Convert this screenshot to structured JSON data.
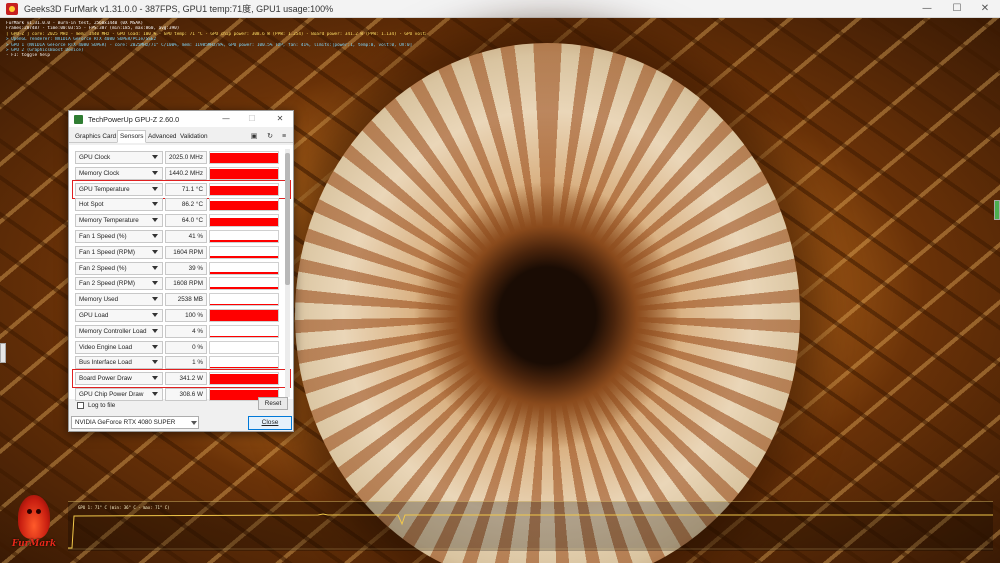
{
  "furmark": {
    "window_title": "Geeks3D FurMark v1.31.0.0 - 387FPS, GPU1 temp:71度, GPU1 usage:100%",
    "overlay": [
      "FurMark v1.31.0.0 - Burn-in test, 2560x1440 (0X MSAA)",
      "Frames:287487 - time:00:03:55 - FPS:387 (min:185, max:860, avg:390)",
      "[ GPU-Z ] core: 2025 MHz - mem: 1440 MHz - GPU load: 100 % - GPU temp: 71 °C - GPU chip power: 308.6 W (PPW: 1.254) - Board power: 341.2 W (PPW: 1.134) - GPU voltage: 0.990 V",
      "> OpenGL renderer: NVIDIA GeForce RTX 4080 SUPER/PCIe/SSE2",
      "> GPU 1 (NVIDIA GeForce RTX 4080 SUPER) - core: 2025MHz/71° C/100%, mem: 11985MHz/8%, GPU power: 100.5% TDP, fan: 41%, limits:[power:1, temp:0, volt:0, OV:0]",
      "> GPU 2 (GraphicsBoost Device)",
      "- F1: toggle help"
    ],
    "graph_label": "GPU 1: 71° C (min: 36° C - max: 71° C)",
    "logo_text": "FurMark"
  },
  "gpuz": {
    "title": "TechPowerUp GPU-Z 2.60.0",
    "tabs": [
      "Graphics Card",
      "Sensors",
      "Advanced",
      "Validation"
    ],
    "active_tab": "Sensors",
    "sensors": [
      {
        "label": "GPU Clock",
        "value": "2025.0 MHz",
        "level": 0.9,
        "highlight": false
      },
      {
        "label": "Memory Clock",
        "value": "1440.2 MHz",
        "level": 0.9,
        "highlight": false
      },
      {
        "label": "GPU Temperature",
        "value": "71.1 °C",
        "level": 0.8,
        "highlight": true
      },
      {
        "label": "Hot Spot",
        "value": "86.2 °C",
        "level": 0.8,
        "highlight": false
      },
      {
        "label": "Memory Temperature",
        "value": "64.0 °C",
        "level": 0.7,
        "highlight": false
      },
      {
        "label": "Fan 1 Speed (%)",
        "value": "41 %",
        "level": 0.2,
        "highlight": false
      },
      {
        "label": "Fan 1 Speed (RPM)",
        "value": "1604 RPM",
        "level": 0.2,
        "highlight": false
      },
      {
        "label": "Fan 2 Speed (%)",
        "value": "39 %",
        "level": 0.2,
        "highlight": false
      },
      {
        "label": "Fan 2 Speed (RPM)",
        "value": "1608 RPM",
        "level": 0.2,
        "highlight": false
      },
      {
        "label": "Memory Used",
        "value": "2538 MB",
        "level": 0.1,
        "highlight": false
      },
      {
        "label": "GPU Load",
        "value": "100 %",
        "level": 1.0,
        "highlight": false
      },
      {
        "label": "Memory Controller Load",
        "value": "4 %",
        "level": 0.08,
        "highlight": false
      },
      {
        "label": "Video Engine Load",
        "value": "0 %",
        "level": 0.0,
        "highlight": false
      },
      {
        "label": "Bus Interface Load",
        "value": "1 %",
        "level": 0.05,
        "highlight": false
      },
      {
        "label": "Board Power Draw",
        "value": "341.2 W",
        "level": 0.9,
        "highlight": true
      },
      {
        "label": "GPU Chip Power Draw",
        "value": "308.6 W",
        "level": 0.9,
        "highlight": false
      }
    ],
    "log_label": "Log to file",
    "reset_label": "Reset",
    "gpu_selected": "NVIDIA GeForce RTX 4080 SUPER",
    "close_label": "Close"
  },
  "colors": {
    "sensor_bar": "#ff0000",
    "highlight_border": "#e02020",
    "overlay_cyan": "#7fd9ff",
    "overlay_yellow": "#ffe066"
  }
}
